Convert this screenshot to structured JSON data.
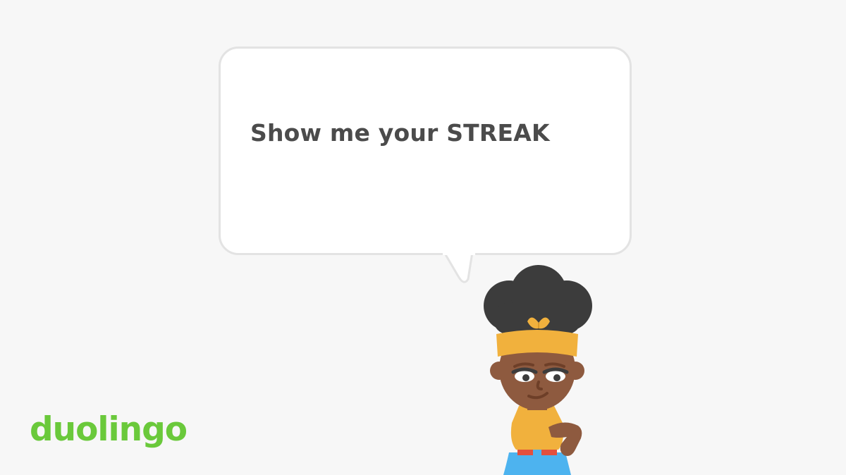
{
  "speech_bubble": {
    "text": "Show me your STREAK"
  },
  "character": {
    "icon": "character-with-headband-icon",
    "colors": {
      "skin": "#8e5a3f",
      "hair": "#3c3c3c",
      "headband": "#f1b13d",
      "shirt": "#f1b13d",
      "jeans": "#4db3ef",
      "belt": "#e3503e"
    }
  },
  "brand": {
    "logo_text": "duolingo",
    "color": "#6ac93b"
  },
  "colors": {
    "background": "#f7f7f7",
    "bubble_fill": "#ffffff",
    "bubble_border": "#e3e3e3",
    "text": "#4b4b4b"
  }
}
